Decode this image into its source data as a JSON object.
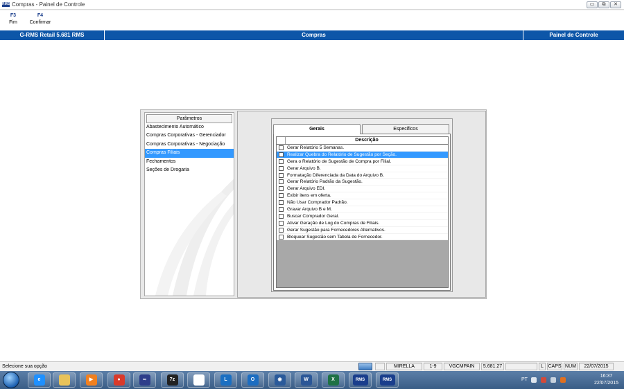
{
  "window": {
    "app_icon_text": "RMS",
    "title": "Compras - Painel de Controle",
    "buttons": [
      "▭",
      "⧉",
      "✕"
    ]
  },
  "toolbar": [
    {
      "key": "F3",
      "label": "Fim"
    },
    {
      "key": "F4",
      "label": "Confirmar"
    }
  ],
  "header": {
    "left": "G-RMS Retail 5.681 RMS",
    "center": "Compras",
    "right": "Painel de Controle"
  },
  "parametros": {
    "title": "Parâmetros",
    "items": [
      "Abastecimento Automático",
      "Compras Corporativas - Gerenciador",
      "Compras Corporativas - Negociação",
      "Compras Filiais",
      "Fechamentos",
      "Seções de Drogaria"
    ],
    "selected_index": 3
  },
  "tabs": {
    "items": [
      "Gerais",
      "Especificos"
    ],
    "active": "Gerais"
  },
  "grid": {
    "column": "Descrição",
    "rows": [
      "Gerar Relatório 5 Semanas.",
      "Realizar Quebra do Relatório de Sugestão por Seção.",
      "Gera o Relatório de Sugestão de Compra por Filial.",
      "Gerar Arquivo B.",
      " Formatação Diferenciada da Data do Arquivo B.",
      "Gerar Relatório Padrão da Sugestão.",
      "Gerar Arquivo EDI.",
      "Exibir itens em oferta.",
      "Não Usar Comprador Padrão.",
      "Gravar Arquivo B e M.",
      "Buscar Comprador Geral.",
      "Ativar Geração de Log do Compras de Filiais.",
      "Gerar Sugestão para Fornecedores Alternativos.",
      "Bloquear Sugestão sem Tabela de Fornecedor."
    ],
    "selected_index": 1
  },
  "status": {
    "message": "Selecione sua opção",
    "user": "MIRELLA",
    "code": "1-9",
    "program": "VGCMPAIN",
    "version": "5.681.27",
    "l": "L",
    "caps": "CAPS",
    "num": "NUM",
    "date": "22/07/2015"
  },
  "taskbar": {
    "apps": [
      {
        "icon": "internet-explorer-icon",
        "glyph": "e",
        "color": "#1e90ff"
      },
      {
        "icon": "folder-icon",
        "glyph": "",
        "color": "#e8c35a"
      },
      {
        "icon": "media-player-icon",
        "glyph": "▶",
        "color": "#f08020"
      },
      {
        "icon": "chrome-icon",
        "glyph": "●",
        "color": "#d93a2b"
      },
      {
        "icon": "link-icon",
        "glyph": "∞",
        "color": "#2d3d8a"
      },
      {
        "icon": "7zip-icon",
        "glyph": "7z",
        "color": "#222222"
      },
      {
        "icon": "document-icon",
        "glyph": "",
        "color": "#ffffff"
      },
      {
        "icon": "lync-icon",
        "glyph": "L",
        "color": "#1a6fc2"
      },
      {
        "icon": "outlook-icon",
        "glyph": "O",
        "color": "#1c6dc1"
      },
      {
        "icon": "network-icon",
        "glyph": "◉",
        "color": "#2a5a9a"
      },
      {
        "icon": "word-icon",
        "glyph": "W",
        "color": "#2b5797"
      },
      {
        "icon": "excel-icon",
        "glyph": "X",
        "color": "#1e7145"
      },
      {
        "icon": "rms-icon",
        "glyph": "RMS",
        "color": "#1a3e8c"
      },
      {
        "icon": "rms-icon",
        "glyph": "RMS",
        "color": "#1a3e8c"
      }
    ],
    "lang": "PT",
    "time": "16:37",
    "date": "22/07/2015"
  },
  "colors": {
    "header_blue": "#0d56a8",
    "selection_blue": "#3399ff"
  }
}
